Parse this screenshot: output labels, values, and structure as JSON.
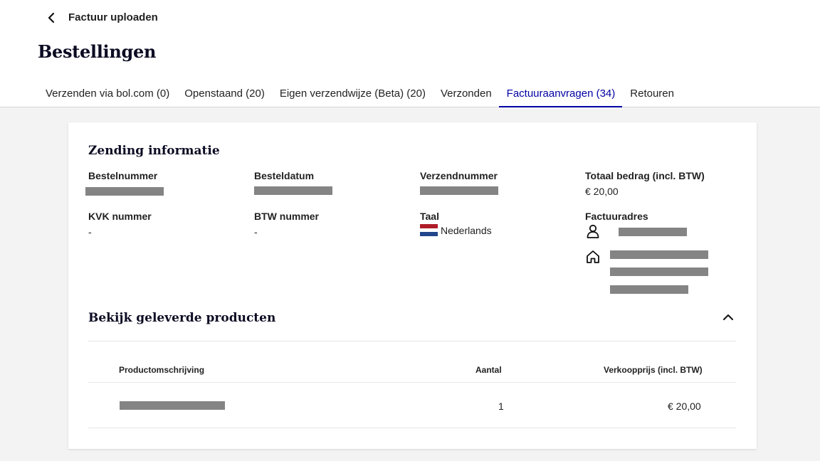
{
  "header": {
    "back_label": "Factuur uploaden",
    "page_title": "Bestellingen"
  },
  "tabs": [
    {
      "label": "Verzenden via bol.com (0)",
      "active": false
    },
    {
      "label": "Openstaand (20)",
      "active": false
    },
    {
      "label": "Eigen verzendwijze (Beta) (20)",
      "active": false
    },
    {
      "label": "Verzonden",
      "active": false
    },
    {
      "label": "Factuuraanvragen (34)",
      "active": true
    },
    {
      "label": "Retouren",
      "active": false
    }
  ],
  "shipment": {
    "title": "Zending informatie",
    "order_number_label": "Bestelnummer",
    "order_date_label": "Besteldatum",
    "shipping_number_label": "Verzendnummer",
    "total_label": "Totaal bedrag (incl. BTW)",
    "total_value": "€ 20,00",
    "kvk_label": "KVK nummer",
    "kvk_value": "-",
    "btw_label": "BTW nummer",
    "btw_value": "-",
    "language_label": "Taal",
    "language_value": "Nederlands",
    "invoice_address_label": "Factuuradres"
  },
  "products": {
    "title": "Bekijk geleverde producten",
    "columns": {
      "description": "Productomschrijving",
      "quantity": "Aantal",
      "price": "Verkoopprijs (incl. BTW)"
    },
    "rows": [
      {
        "quantity": "1",
        "price": "€ 20,00"
      }
    ]
  },
  "colors": {
    "accent": "#0000a4",
    "title": "#0b0b23",
    "redaction": "#848484",
    "background": "#f3f3f3"
  }
}
